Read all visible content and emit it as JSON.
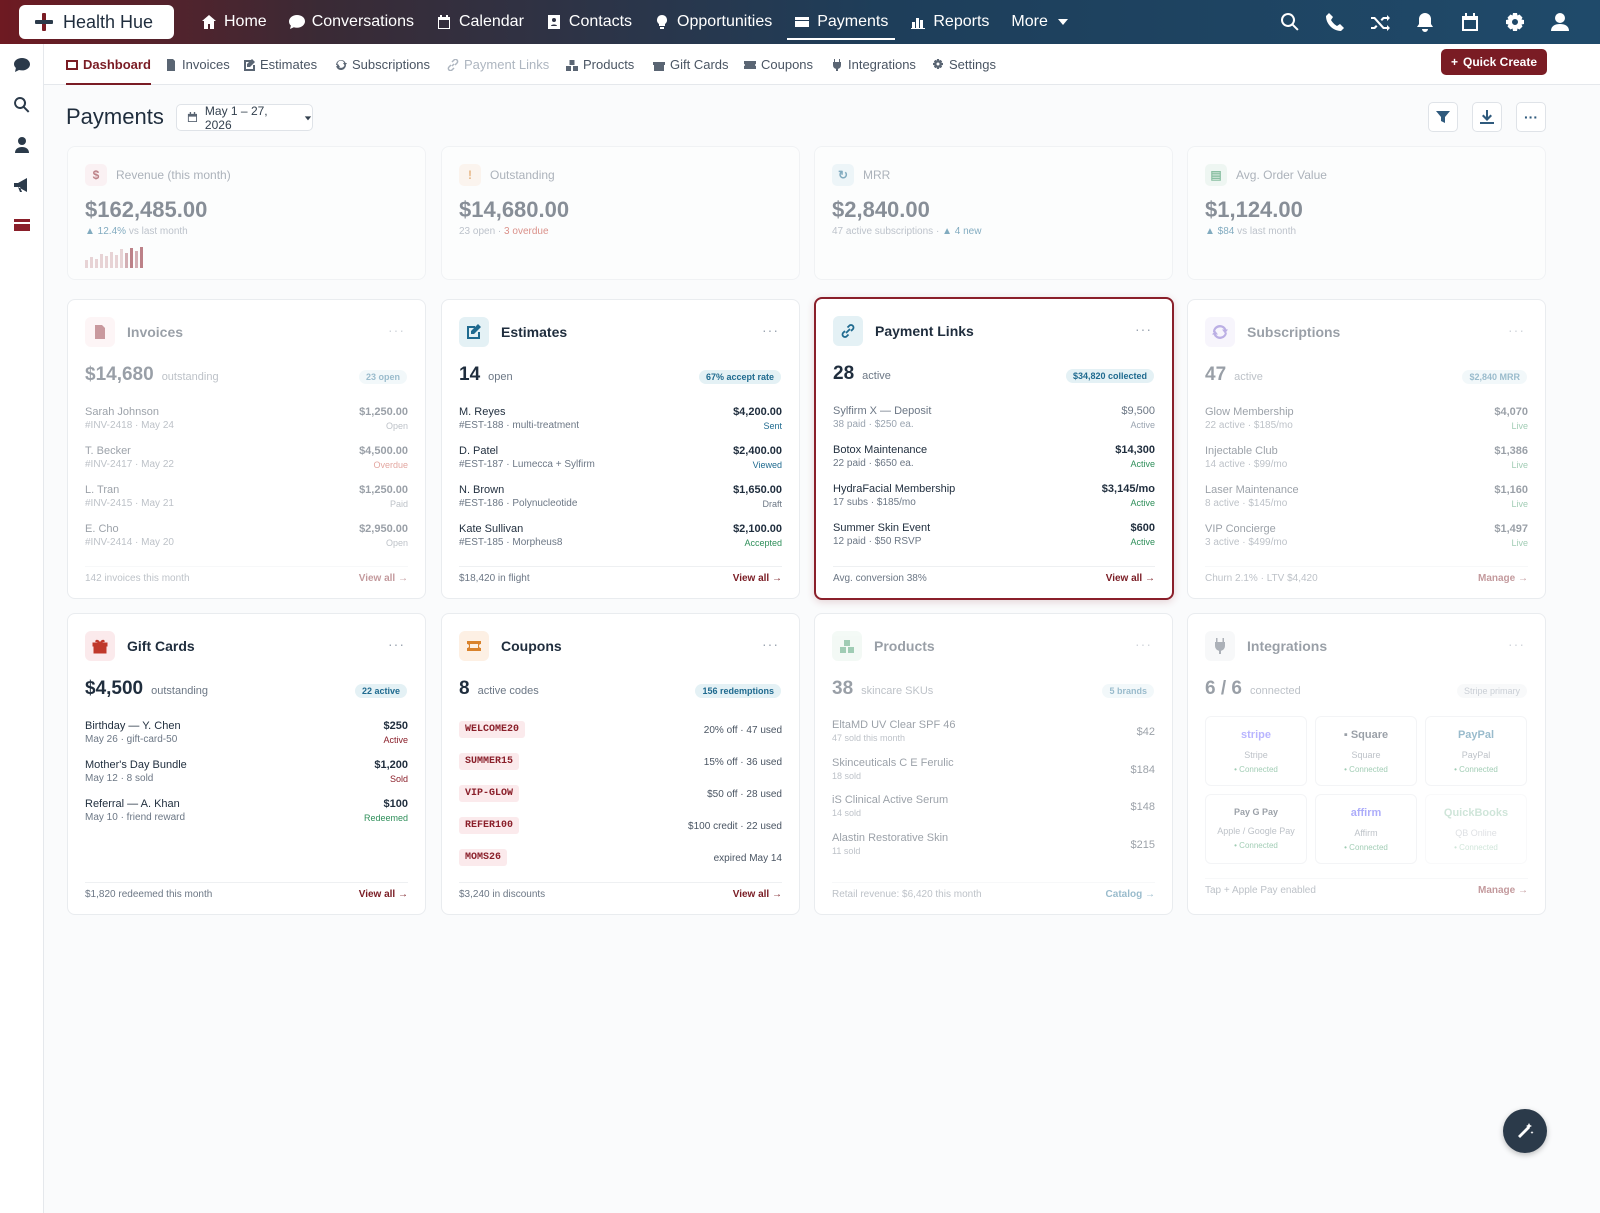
{
  "app": {
    "logo": "Health Hue"
  },
  "nav": [
    {
      "label": "Home",
      "icon": "home-icon"
    },
    {
      "label": "Conversations",
      "icon": "chat-icon"
    },
    {
      "label": "Calendar",
      "icon": "calendar-icon"
    },
    {
      "label": "Contacts",
      "icon": "contacts-icon"
    },
    {
      "label": "Opportunities",
      "icon": "bulb-icon"
    },
    {
      "label": "Payments",
      "icon": "payments-icon",
      "active": true
    },
    {
      "label": "Reports",
      "icon": "chart-icon"
    },
    {
      "label": "More",
      "icon": "chevron-down-icon"
    }
  ],
  "subnav": [
    {
      "label": "Dashboard",
      "active": true
    },
    {
      "label": "Invoices"
    },
    {
      "label": "Estimates"
    },
    {
      "label": "Subscriptions"
    },
    {
      "label": "Payment Links",
      "dim": true
    },
    {
      "label": "Products"
    },
    {
      "label": "Gift Cards"
    },
    {
      "label": "Coupons"
    },
    {
      "label": "Integrations"
    },
    {
      "label": "Settings"
    }
  ],
  "quick_create": "Quick Create",
  "page": {
    "title": "Payments",
    "date_range": "May 1 – 27, 2026"
  },
  "kpis": {
    "revenue": {
      "label": "Revenue (this month)",
      "value": "$162,485.00",
      "delta": "▲ 12.4%",
      "delta_note": "vs last month",
      "icon_text": "$"
    },
    "outstanding": {
      "label": "Outstanding",
      "value": "$14,680.00",
      "sub": "23 open · ",
      "sub_red": "3 overdue",
      "icon_text": "!"
    },
    "mrr": {
      "label": "MRR",
      "value": "$2,840.00",
      "sub": "47 active subscriptions · ",
      "sub_green": "▲ 4 new",
      "icon_text": "↻"
    },
    "aov": {
      "label": "Avg. Order Value",
      "value": "$1,124.00",
      "delta": "▲ $84",
      "delta_note": "vs last month",
      "icon_text": "▤"
    }
  },
  "cards": {
    "invoices": {
      "title": "Invoices",
      "big": "$14,680",
      "unit": "outstanding",
      "pill": "23 open",
      "rows": [
        {
          "l1": "Sarah Johnson",
          "l2": "#INV-2418 · May 24",
          "r1": "$1,250.00",
          "r2": "Open"
        },
        {
          "l1": "T. Becker",
          "l2": "#INV-2417 · May 22",
          "r1": "$4,500.00",
          "r2": "Overdue"
        },
        {
          "l1": "L. Tran",
          "l2": "#INV-2415 · May 21",
          "r1": "$1,250.00",
          "r2": "Paid"
        },
        {
          "l1": "E. Cho",
          "l2": "#INV-2414 · May 20",
          "r1": "$2,950.00",
          "r2": "Open"
        }
      ],
      "foot_l": "142 invoices this month",
      "foot_r": "View all →"
    },
    "estimates": {
      "title": "Estimates",
      "big": "14",
      "unit": "open",
      "pill": "67% accept rate",
      "rows": [
        {
          "l1": "M. Reyes",
          "l2": "#EST-188 · multi-treatment",
          "r1": "$4,200.00",
          "r2": "Sent"
        },
        {
          "l1": "D. Patel",
          "l2": "#EST-187 · Lumecca + Sylfirm",
          "r1": "$2,400.00",
          "r2": "Viewed"
        },
        {
          "l1": "N. Brown",
          "l2": "#EST-186 · Polynucleotide",
          "r1": "$1,650.00",
          "r2": "Draft"
        },
        {
          "l1": "Kate Sullivan",
          "l2": "#EST-185 · Morpheus8",
          "r1": "$2,100.00",
          "r2": "Accepted"
        }
      ],
      "foot_l": "$18,420 in flight",
      "foot_r": "View all →"
    },
    "payment_links": {
      "title": "Payment Links",
      "big": "28",
      "unit": "active",
      "pill": "$34,820 collected",
      "rows": [
        {
          "l1": "Sylfirm X — Deposit",
          "l2": "38 paid · $250 ea.",
          "r1": "$9,500",
          "r2": "Active"
        },
        {
          "l1": "Botox Maintenance",
          "l2": "22 paid · $650 ea.",
          "r1": "$14,300",
          "r2": "Active"
        },
        {
          "l1": "HydraFacial Membership",
          "l2": "17 subs · $185/mo",
          "r1": "$3,145/mo",
          "r2": "Active"
        },
        {
          "l1": "Summer Skin Event",
          "l2": "12 paid · $50 RSVP",
          "r1": "$600",
          "r2": "Active"
        }
      ],
      "foot_l": "Avg. conversion 38%",
      "foot_r": "View all →"
    },
    "subscriptions": {
      "title": "Subscriptions",
      "big": "47",
      "unit": "active",
      "pill": "$2,840 MRR",
      "rows": [
        {
          "l1": "Glow Membership",
          "l2": "22 active · $185/mo",
          "r1": "$4,070",
          "r2": "Live"
        },
        {
          "l1": "Injectable Club",
          "l2": "14 active · $99/mo",
          "r1": "$1,386",
          "r2": "Live"
        },
        {
          "l1": "Laser Maintenance",
          "l2": "8 active · $145/mo",
          "r1": "$1,160",
          "r2": "Live"
        },
        {
          "l1": "VIP Concierge",
          "l2": "3 active · $499/mo",
          "r1": "$1,497",
          "r2": "Live"
        }
      ],
      "foot_l": "Churn 2.1% · LTV $4,420",
      "foot_r": "Manage →"
    },
    "gift_cards": {
      "title": "Gift Cards",
      "big": "$4,500",
      "unit": "outstanding",
      "pill": "22 active",
      "rows": [
        {
          "l1": "Birthday — Y. Chen",
          "l2": "May 26 · gift-card-50",
          "r1": "$250",
          "r2": "Active"
        },
        {
          "l1": "Mother's Day Bundle",
          "l2": "May 12 · 8 sold",
          "r1": "$1,200",
          "r2": "Sold"
        },
        {
          "l1": "Referral — A. Khan",
          "l2": "May 10 · friend reward",
          "r1": "$100",
          "r2": "Redeemed"
        }
      ],
      "foot_l": "$1,820 redeemed this month",
      "foot_r": "View all →"
    },
    "coupons": {
      "title": "Coupons",
      "big": "8",
      "unit": "active codes",
      "pill": "156 redemptions",
      "rows": [
        {
          "code": "WELCOME20",
          "info": "20% off · 47 used"
        },
        {
          "code": "SUMMER15",
          "info": "15% off · 36 used"
        },
        {
          "code": "VIP-GLOW",
          "info": "$50 off · 28 used"
        },
        {
          "code": "REFER100",
          "info": "$100 credit · 22 used"
        },
        {
          "code": "MOMS26",
          "info": "expired May 14"
        }
      ],
      "foot_l": "$3,240 in discounts",
      "foot_r": "View all →"
    },
    "products": {
      "title": "Products",
      "big": "38",
      "unit": "skincare SKUs",
      "pill": "5 brands",
      "rows": [
        {
          "l1": "EltaMD UV Clear SPF 46",
          "l2": "47 sold this month",
          "r1": "$42"
        },
        {
          "l1": "Skinceuticals C E Ferulic",
          "l2": "18 sold",
          "r1": "$184"
        },
        {
          "l1": "iS Clinical Active Serum",
          "l2": "14 sold",
          "r1": "$148"
        },
        {
          "l1": "Alastin Restorative Skin",
          "l2": "11 sold",
          "r1": "$215"
        }
      ],
      "foot_l": "Retail revenue: $6,420 this month",
      "foot_r": "Catalog →"
    },
    "integrations": {
      "title": "Integrations",
      "big": "6 / 6",
      "unit": "connected",
      "pill": "Stripe primary",
      "tiles": [
        {
          "brand": "stripe",
          "name": "Stripe",
          "status": "• Connected",
          "color": "#635bff"
        },
        {
          "brand": "▪ Square",
          "name": "Square",
          "status": "• Connected",
          "color": "#1f2d3d"
        },
        {
          "brand": "PayPal",
          "name": "PayPal",
          "status": "• Connected",
          "color": "#1f6a8f"
        },
        {
          "brand": " Pay  G Pay",
          "name": "Apple / Google Pay",
          "status": "• Connected",
          "color": "#1f2d3d"
        },
        {
          "brand": "affirm",
          "name": "Affirm",
          "status": "• Connected",
          "color": "#4a4af4"
        },
        {
          "brand": "QuickBooks",
          "name": "QB Online",
          "status": "• Connected",
          "color": "#2f8f5a"
        }
      ],
      "foot_l": "Tap + Apple Pay enabled",
      "foot_r": "Manage →"
    }
  }
}
